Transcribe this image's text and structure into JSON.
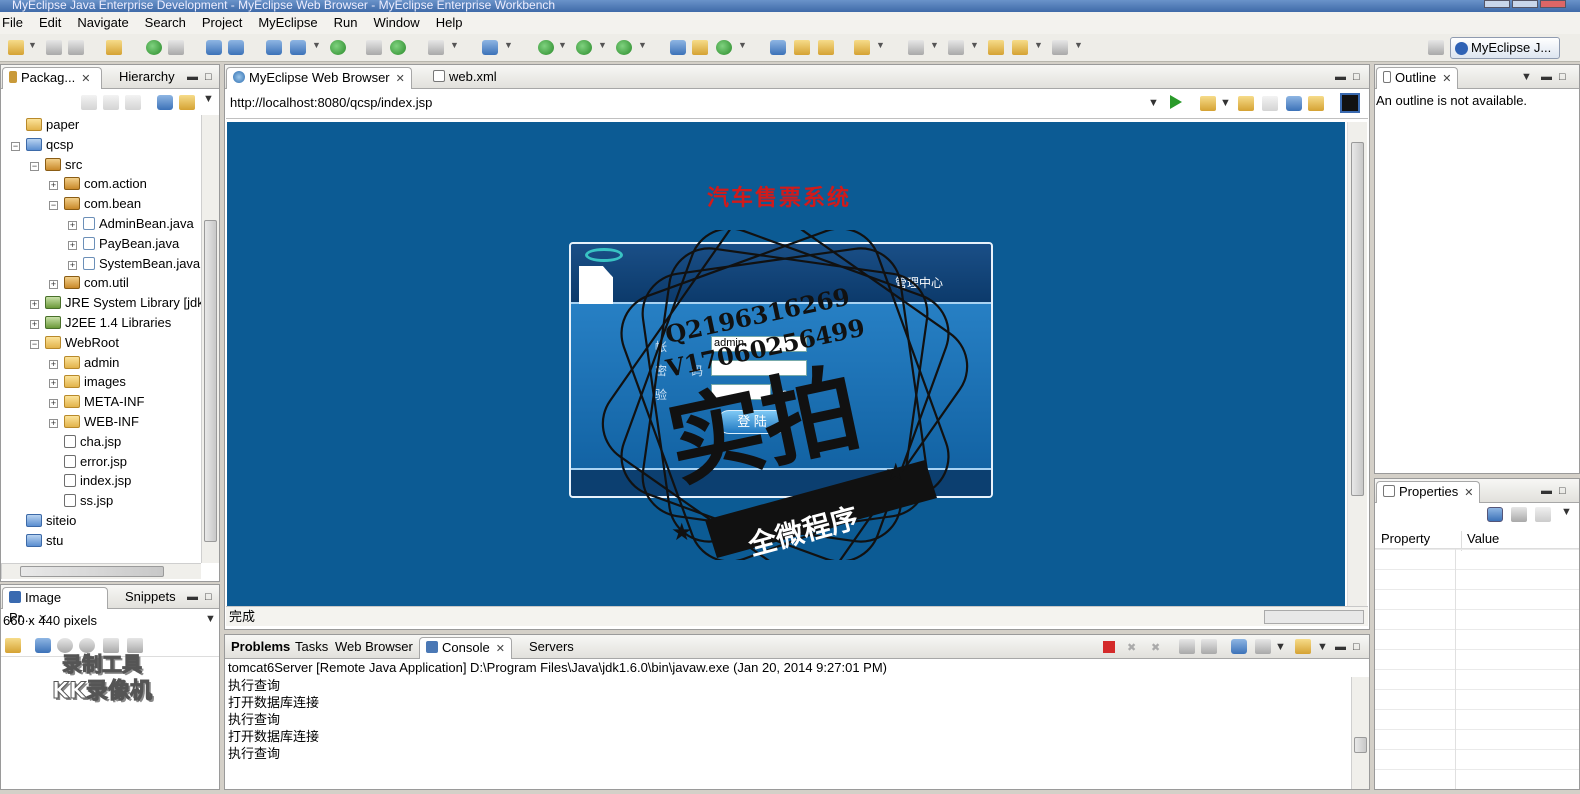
{
  "window": {
    "title": "MyEclipse Java Enterprise Development - MyEclipse Web Browser - MyEclipse Enterprise Workbench"
  },
  "menu": [
    "File",
    "Edit",
    "Navigate",
    "Search",
    "Project",
    "MyEclipse",
    "Run",
    "Window",
    "Help"
  ],
  "perspective": {
    "label": "MyEclipse J..."
  },
  "explorer": {
    "tabs": [
      "Packag...",
      "Hierarchy"
    ],
    "tree": [
      {
        "label": "paper",
        "icon": "folder-icon",
        "level": 0,
        "expanded": null
      },
      {
        "label": "qcsp",
        "icon": "project-icon",
        "level": 0,
        "expanded": true
      },
      {
        "label": "src",
        "icon": "source-folder-icon",
        "level": 1,
        "expanded": true
      },
      {
        "label": "com.action",
        "icon": "package-icon",
        "level": 2,
        "expanded": false
      },
      {
        "label": "com.bean",
        "icon": "package-icon",
        "level": 2,
        "expanded": true
      },
      {
        "label": "AdminBean.java",
        "icon": "java-file-icon",
        "level": 3,
        "expanded": false
      },
      {
        "label": "PayBean.java",
        "icon": "java-file-icon",
        "level": 3,
        "expanded": false
      },
      {
        "label": "SystemBean.java",
        "icon": "java-file-icon",
        "level": 3,
        "expanded": false
      },
      {
        "label": "com.util",
        "icon": "package-icon",
        "level": 2,
        "expanded": false
      },
      {
        "label": "JRE System Library [jdk1",
        "icon": "library-icon",
        "level": 1,
        "expanded": false
      },
      {
        "label": "J2EE 1.4 Libraries",
        "icon": "library-icon",
        "level": 1,
        "expanded": false
      },
      {
        "label": "WebRoot",
        "icon": "folder-icon",
        "level": 1,
        "expanded": true
      },
      {
        "label": "admin",
        "icon": "folder-icon",
        "level": 2,
        "expanded": false
      },
      {
        "label": "images",
        "icon": "folder-icon",
        "level": 2,
        "expanded": false
      },
      {
        "label": "META-INF",
        "icon": "folder-icon",
        "level": 2,
        "expanded": false
      },
      {
        "label": "WEB-INF",
        "icon": "folder-icon",
        "level": 2,
        "expanded": false
      },
      {
        "label": "cha.jsp",
        "icon": "jsp-file-icon",
        "level": 2,
        "expanded": null
      },
      {
        "label": "error.jsp",
        "icon": "jsp-file-icon",
        "level": 2,
        "expanded": null
      },
      {
        "label": "index.jsp",
        "icon": "jsp-file-icon",
        "level": 2,
        "expanded": null
      },
      {
        "label": "ss.jsp",
        "icon": "jsp-file-icon",
        "level": 2,
        "expanded": null
      },
      {
        "label": "siteio",
        "icon": "project-icon",
        "level": 0,
        "expanded": null
      },
      {
        "label": "stu",
        "icon": "project-icon",
        "level": 0,
        "expanded": null
      }
    ]
  },
  "image_preview": {
    "tabs": [
      "Image Pr...",
      "Snippets"
    ],
    "size": "660 x 440 pixels"
  },
  "editor": {
    "tabs": [
      "MyEclipse Web Browser",
      "web.xml"
    ],
    "url": "http://localhost:8080/qcsp/index.jsp",
    "status": "完成"
  },
  "webpage": {
    "system_title": "汽车售票系统",
    "panel_title": "管理中心",
    "account_label": "帐",
    "account_value": "admin",
    "password_label": "密",
    "password_label2": "码",
    "verify_label": "验",
    "verify_code": "61",
    "login_button": "登 陆"
  },
  "overlay": {
    "qq": "Q2196316269",
    "vx": "V17060256499",
    "big": "实拍",
    "banner": "全微程序"
  },
  "outline": {
    "tab": "Outline",
    "message": "An outline is not available."
  },
  "properties": {
    "tab": "Properties",
    "columns": [
      "Property",
      "Value"
    ]
  },
  "console": {
    "tabs": [
      "Problems",
      "Tasks",
      "Web Browser",
      "Console",
      "Servers"
    ],
    "header": "tomcat6Server [Remote Java Application] D:\\Program Files\\Java\\jdk1.6.0\\bin\\javaw.exe (Jan 20, 2014 9:27:01 PM)",
    "lines": [
      "执行查询",
      "打开数据库连接",
      "执行查询",
      "打开数据库连接",
      "执行查询"
    ]
  },
  "recorder_watermark": {
    "line1": "录制工具",
    "line2": "KK录像机"
  }
}
